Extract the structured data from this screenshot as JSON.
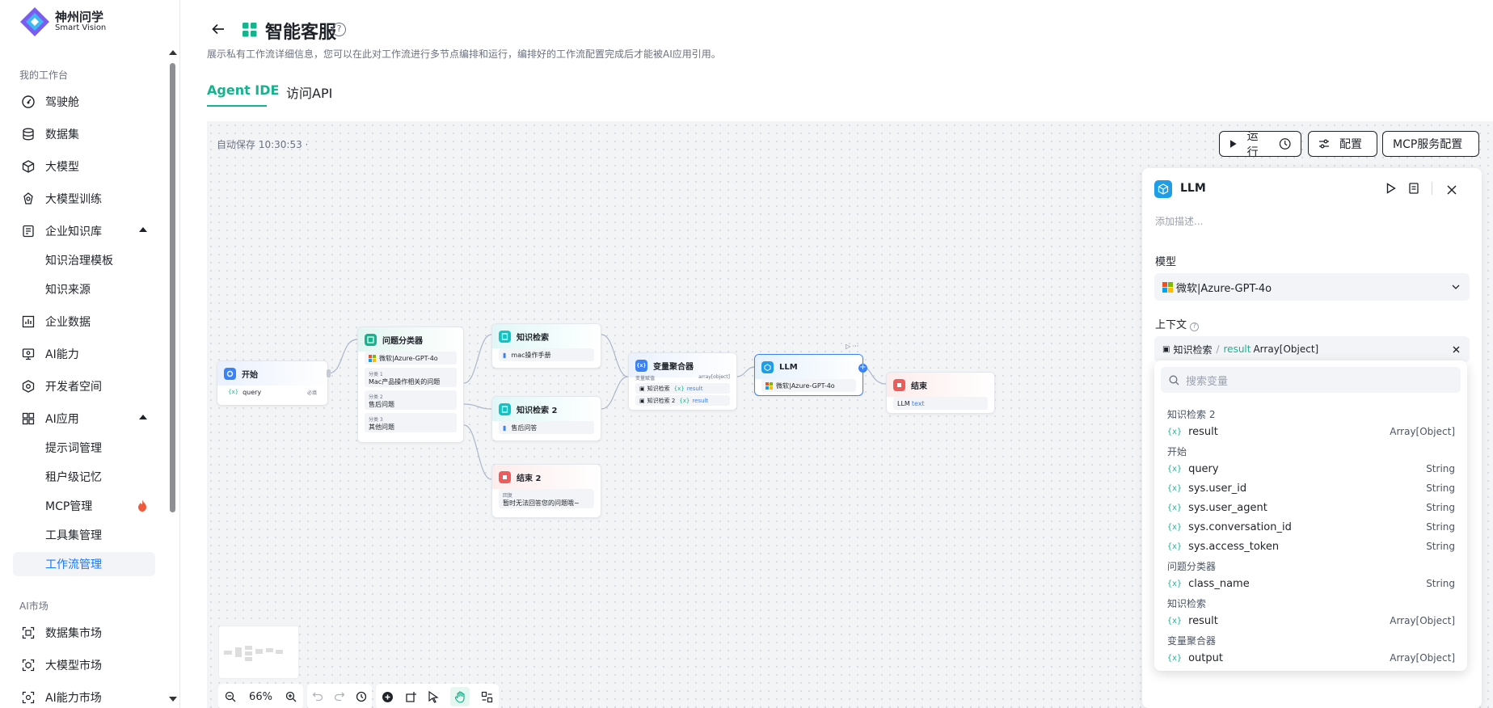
{
  "brand": {
    "name_cn": "神州问学",
    "name_en": "Smart Vision"
  },
  "sidebar": {
    "section_workspace": "我的工作台",
    "items": [
      {
        "label": "驾驶舱",
        "icon": "dashboard-icon"
      },
      {
        "label": "数据集",
        "icon": "database-icon"
      },
      {
        "label": "大模型",
        "icon": "cube-icon"
      },
      {
        "label": "大模型训练",
        "icon": "training-icon"
      },
      {
        "label": "企业知识库",
        "icon": "knowledge-base-icon"
      },
      {
        "label": "企业数据",
        "icon": "bar-chart-icon"
      },
      {
        "label": "AI能力",
        "icon": "monitor-icon"
      },
      {
        "label": "开发者空间",
        "icon": "developer-icon"
      },
      {
        "label": "AI应用",
        "icon": "apps-icon"
      }
    ],
    "knowledge_sub": [
      "知识治理模板",
      "知识来源"
    ],
    "ai_app_sub": [
      "提示词管理",
      "租户级记忆",
      "MCP管理",
      "工具集管理",
      "工作流管理"
    ],
    "section_market": "AI市场",
    "market_items": [
      "数据集市场",
      "大模型市场",
      "AI能力市场"
    ],
    "active_item": "工作流管理",
    "accent_color": "#1677ff"
  },
  "header": {
    "title": "智能客服",
    "subtitle": "展示私有工作流详细信息，您可以在此对工作流进行多节点编排和运行，编排好的工作流配置完成后才能被AI应用引用。",
    "tabs": [
      "Agent IDE",
      "访问API"
    ],
    "active_tab": "Agent IDE",
    "accent_color": "#16b38f"
  },
  "canvas": {
    "autosave": "自动保存 10:30:53 ·",
    "buttons": {
      "run": "运行",
      "config": "配置",
      "mcp": "MCP服务配置"
    },
    "zoom": "66%"
  },
  "nodes": {
    "start": {
      "title": "开始",
      "var": "query",
      "required": "必填"
    },
    "classifier": {
      "title": "问题分类器",
      "model": "微软|Azure-GPT-4o",
      "classes": [
        {
          "label": "分类 1",
          "text": "Mac产品操作相关的问题"
        },
        {
          "label": "分类 2",
          "text": "售后问题"
        },
        {
          "label": "分类 3",
          "text": "其他问题"
        }
      ]
    },
    "kb1": {
      "title": "知识检索",
      "dataset": "mac操作手册"
    },
    "kb2": {
      "title": "知识检索 2",
      "dataset": "售后问答"
    },
    "end2": {
      "title": "结束 2",
      "label": "回复",
      "text": "暂时无法回答您的问题哦~"
    },
    "aggregator": {
      "title": "变量聚合器",
      "var_label": "变量赋值",
      "type": "array[object]",
      "rows": [
        {
          "source": "知识检索",
          "var": "result"
        },
        {
          "source": "知识检索 2",
          "var": "result"
        }
      ]
    },
    "llm": {
      "title": "LLM",
      "model": "微软|Azure-GPT-4o"
    },
    "end": {
      "title": "结束",
      "output_prefix": "LLM",
      "output_var": "text"
    }
  },
  "panel": {
    "title": "LLM",
    "description_placeholder": "添加描述...",
    "model_label": "模型",
    "model_value": "微软|Azure-GPT-4o",
    "context_label": "上下文",
    "context_source": "知识检索",
    "context_var": "result",
    "context_type": "Array[Object]",
    "search_placeholder": "搜索变量"
  },
  "var_groups": [
    {
      "group": "知识检索 2",
      "vars": [
        {
          "name": "result",
          "type": "Array[Object]"
        }
      ]
    },
    {
      "group": "开始",
      "vars": [
        {
          "name": "query",
          "type": "String"
        },
        {
          "name": "sys.user_id",
          "type": "String"
        },
        {
          "name": "sys.user_agent",
          "type": "String"
        },
        {
          "name": "sys.conversation_id",
          "type": "String"
        },
        {
          "name": "sys.access_token",
          "type": "String"
        }
      ]
    },
    {
      "group": "问题分类器",
      "vars": [
        {
          "name": "class_name",
          "type": "String"
        }
      ]
    },
    {
      "group": "知识检索",
      "vars": [
        {
          "name": "result",
          "type": "Array[Object]"
        }
      ]
    },
    {
      "group": "变量聚合器",
      "vars": [
        {
          "name": "output",
          "type": "Array[Object]"
        }
      ]
    }
  ]
}
